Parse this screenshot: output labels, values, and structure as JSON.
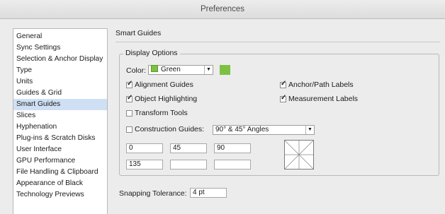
{
  "window": {
    "title": "Preferences"
  },
  "sidebar": {
    "items": [
      {
        "label": "General"
      },
      {
        "label": "Sync Settings"
      },
      {
        "label": "Selection & Anchor Display"
      },
      {
        "label": "Type"
      },
      {
        "label": "Units"
      },
      {
        "label": "Guides & Grid"
      },
      {
        "label": "Smart Guides",
        "selected": true
      },
      {
        "label": "Slices"
      },
      {
        "label": "Hyphenation"
      },
      {
        "label": "Plug-ins & Scratch Disks"
      },
      {
        "label": "User Interface"
      },
      {
        "label": "GPU Performance"
      },
      {
        "label": "File Handling & Clipboard"
      },
      {
        "label": "Appearance of Black"
      },
      {
        "label": "Technology Previews"
      }
    ]
  },
  "main": {
    "section_title": "Smart Guides",
    "display_options": {
      "legend": "Display Options",
      "color_label": "Color:",
      "color_value": "Green",
      "color_hex": "#7dc142",
      "checkboxes": {
        "alignment_guides": {
          "label": "Alignment Guides",
          "checked": true
        },
        "object_highlighting": {
          "label": "Object Highlighting",
          "checked": true
        },
        "transform_tools": {
          "label": "Transform Tools",
          "checked": false
        },
        "construction_guides": {
          "label": "Construction Guides:",
          "checked": false
        },
        "anchor_path_labels": {
          "label": "Anchor/Path Labels",
          "checked": true
        },
        "measurement_labels": {
          "label": "Measurement Labels",
          "checked": true
        }
      },
      "construction_angles_value": "90° & 45° Angles",
      "angle_fields": [
        "0",
        "45",
        "90",
        "135",
        "",
        ""
      ]
    },
    "snapping": {
      "label": "Snapping Tolerance:",
      "value": "4 pt"
    }
  }
}
